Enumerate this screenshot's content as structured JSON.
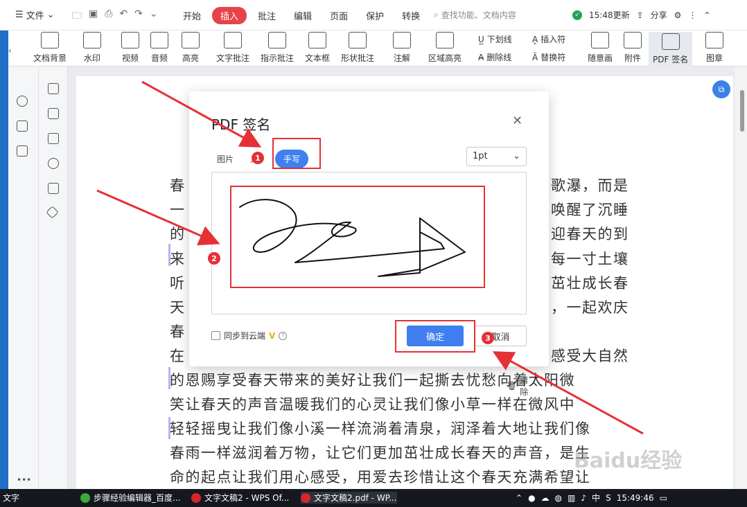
{
  "menubar": {
    "file_label": "文件",
    "tabs": [
      "开始",
      "插入",
      "批注",
      "编辑",
      "页面",
      "保护",
      "转换"
    ],
    "active_tab": "插入",
    "search_placeholder": "查找功能、文档内容",
    "update_label": "15:48更新",
    "share_label": "分享"
  },
  "ribbon": {
    "items": [
      "文档背景",
      "水印",
      "视频",
      "音频",
      "高亮",
      "文字批注",
      "指示批注",
      "文本框",
      "形状批注",
      "注解",
      "区域高亮"
    ],
    "small_top": [
      "下划线",
      "插入符"
    ],
    "small_bottom": [
      "删除线",
      "替换符"
    ],
    "right_items": [
      "随意画",
      "附件",
      "PDF 签名",
      "图章"
    ]
  },
  "document": {
    "lines_full": [
      "的恩赐享受春天带来的美好让我们一起撕去忧愁向着太阳微",
      "笑让春天的声音温暖我们的心灵让我们像小草一样在微风中",
      "轻轻摇曳让我们像小溪一样流淌着清泉，润泽着大地让我们像",
      "春雨一样滋润着万物，让它们更加茁壮成长春天的声音，是生",
      "命的起点让我们用心感受，用爱去珍惜让这个春天充满希望让"
    ],
    "left_frags": [
      "春",
      "一",
      "的",
      "来",
      "听",
      "天",
      "春",
      "在"
    ],
    "right_frags": [
      "歌瀑，而是",
      "唤醒了沉睡",
      "迎春天的到",
      "每一寸土壤",
      "茁壮成长春",
      "，一起欢庆",
      "感受大自然"
    ]
  },
  "dialog": {
    "title": "PDF 签名",
    "tab_image": "图片",
    "tab_input": "入",
    "tab_handwrite": "手写",
    "stroke_size": "1pt",
    "clear_label": "清除",
    "sync_label": "同步到云端",
    "vip_label": "V",
    "ok_label": "确定",
    "cancel_label": "取消"
  },
  "annotations": {
    "badges": [
      "1",
      "2",
      "3"
    ],
    "color": "#e53036"
  },
  "taskbar": {
    "start_text": "文字",
    "items": [
      "步骤经验编辑器_百度...",
      "文字文稿2 - WPS Of...",
      "文字文稿2.pdf - WP..."
    ],
    "ime": "中",
    "time": "15:49:46"
  },
  "watermark": "Baidu经验",
  "colors": {
    "accent": "#3f7ff0",
    "tab_active": "#e7434b",
    "annotation": "#e53036"
  }
}
